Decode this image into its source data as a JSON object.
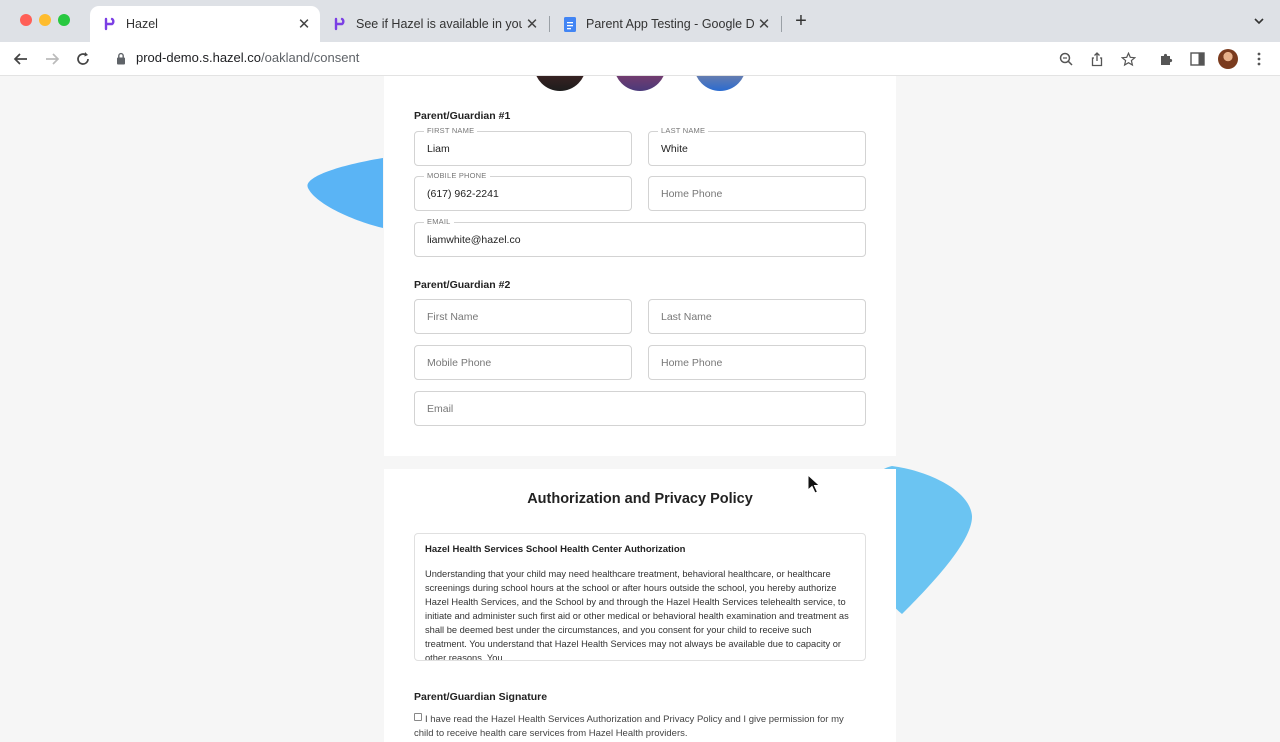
{
  "browser": {
    "tabs": [
      {
        "title": "Hazel",
        "active": true
      },
      {
        "title": "See if Hazel is available in your",
        "active": false
      },
      {
        "title": "Parent App Testing - Google D",
        "active": false
      }
    ],
    "url_host": "prod-demo.s.hazel.co",
    "url_path": "/oakland/consent"
  },
  "guardian1": {
    "heading": "Parent/Guardian #1",
    "first_name_label": "FIRST NAME",
    "first_name": "Liam",
    "last_name_label": "LAST NAME",
    "last_name": "White",
    "mobile_label": "MOBILE PHONE",
    "mobile": "(617) 962-2241",
    "home_phone_placeholder": "Home Phone",
    "email_label": "EMAIL",
    "email": "liamwhite@hazel.co"
  },
  "guardian2": {
    "heading": "Parent/Guardian #2",
    "first_name_placeholder": "First Name",
    "last_name_placeholder": "Last Name",
    "mobile_placeholder": "Mobile Phone",
    "home_phone_placeholder": "Home Phone",
    "email_placeholder": "Email"
  },
  "authorization": {
    "title": "Authorization and Privacy Policy",
    "policy_heading": "Hazel Health Services School Health Center Authorization",
    "policy_text": "Understanding that your child may need healthcare treatment, behavioral healthcare, or healthcare screenings during school hours at the school or after hours outside the school, you hereby authorize Hazel Health Services, and the School by and through the Hazel Health Services telehealth service, to initiate and administer such first aid or other medical or behavioral health examination and treatment as shall be deemed best under the circumstances, and you consent for your child to receive such treatment. You understand that Hazel Health Services may not always be available due to capacity or other reasons. You",
    "signature_heading": "Parent/Guardian Signature",
    "consent_text": "I have read the Hazel Health Services Authorization and Privacy Policy and I give permission for my child to receive health care services from Hazel Health providers."
  },
  "colors": {
    "accent_blue": "#5ab4f5",
    "hazel_purple": "#7b3fe4"
  }
}
